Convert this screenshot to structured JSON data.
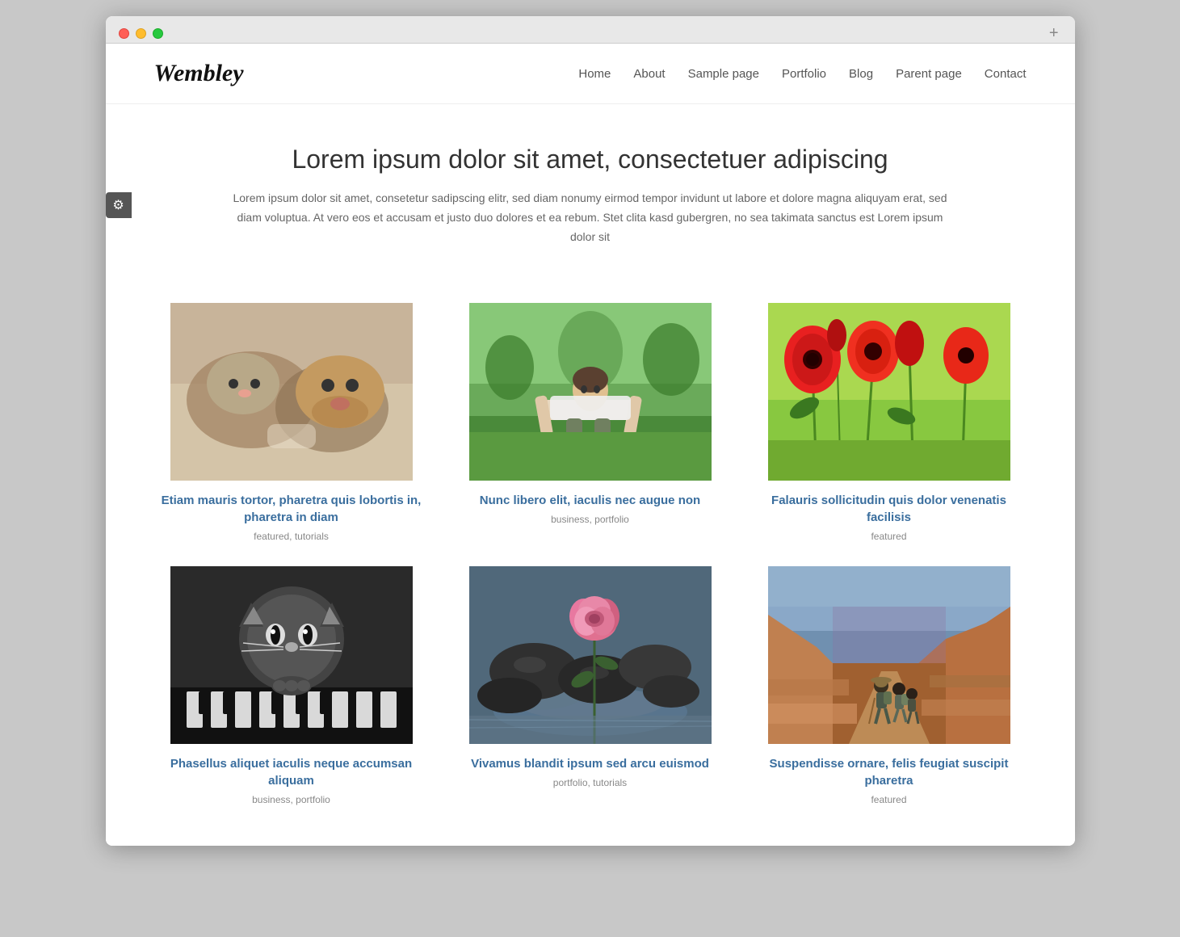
{
  "browser": {
    "dots": [
      "red",
      "yellow",
      "green"
    ],
    "add_button": "+"
  },
  "site": {
    "logo": "Wembley",
    "nav": [
      {
        "label": "Home",
        "href": "#"
      },
      {
        "label": "About",
        "href": "#"
      },
      {
        "label": "Sample page",
        "href": "#"
      },
      {
        "label": "Portfolio",
        "href": "#"
      },
      {
        "label": "Blog",
        "href": "#"
      },
      {
        "label": "Parent page",
        "href": "#"
      },
      {
        "label": "Contact",
        "href": "#"
      }
    ]
  },
  "hero": {
    "title": "Lorem ipsum dolor sit amet, consectetuer adipiscing",
    "text": "Lorem ipsum dolor sit amet, consetetur sadipscing elitr, sed diam nonumy eirmod tempor invidunt ut labore et dolore magna aliquyam erat, sed diam voluptua. At vero eos et accusam et justo duo dolores et ea rebum. Stet clita kasd gubergren, no sea takimata sanctus est Lorem ipsum dolor sit"
  },
  "posts": [
    {
      "id": 1,
      "title": "Etiam mauris tortor, pharetra quis lobortis in, pharetra in diam",
      "tags": "featured, tutorials",
      "img_type": "cat-dog"
    },
    {
      "id": 2,
      "title": "Nunc libero elit, iaculis nec augue non",
      "tags": "business, portfolio",
      "img_type": "pushup"
    },
    {
      "id": 3,
      "title": "Falauris sollicitudin quis dolor venenatis facilisis",
      "tags": "featured",
      "img_type": "poppies"
    },
    {
      "id": 4,
      "title": "Phasellus aliquet iaculis neque accumsan aliquam",
      "tags": "business, portfolio",
      "img_type": "cat-bw"
    },
    {
      "id": 5,
      "title": "Vivamus blandit ipsum sed arcu euismod",
      "tags": "portfolio, tutorials",
      "img_type": "rose"
    },
    {
      "id": 6,
      "title": "Suspendisse ornare, felis feugiat suscipit pharetra",
      "tags": "featured",
      "img_type": "hikers"
    }
  ],
  "gear_icon": "⚙"
}
